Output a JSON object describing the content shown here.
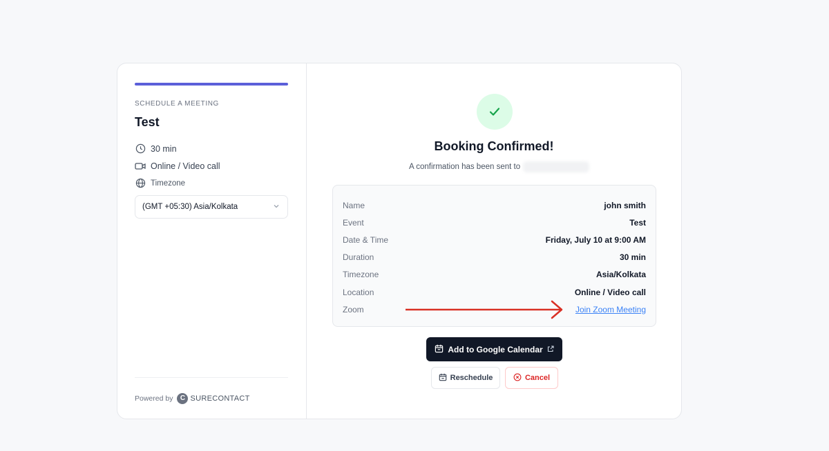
{
  "sidebar": {
    "eyebrow": "SCHEDULE A MEETING",
    "event_title": "Test",
    "duration": "30 min",
    "location": "Online / Video call",
    "timezone_label": "Timezone",
    "timezone_value": "(GMT +05:30) Asia/Kolkata",
    "powered_by": "Powered by",
    "brand_logo_letter": "C",
    "brand_name": "SURECONTACT",
    "accent_color": "#5b5fd9"
  },
  "confirmation": {
    "title": "Booking Confirmed!",
    "subtitle": "A confirmation has been sent to",
    "success_color": "#16a34a"
  },
  "details": [
    {
      "label": "Name",
      "value": "john smith"
    },
    {
      "label": "Event",
      "value": "Test"
    },
    {
      "label": "Date & Time",
      "value": "Friday, July 10 at 9:00 AM"
    },
    {
      "label": "Duration",
      "value": "30 min"
    },
    {
      "label": "Timezone",
      "value": "Asia/Kolkata"
    },
    {
      "label": "Location",
      "value": "Online / Video call"
    },
    {
      "label": "Zoom",
      "value": "Join Zoom Meeting"
    }
  ],
  "actions": {
    "add_calendar": "Add to Google Calendar",
    "reschedule": "Reschedule",
    "cancel": "Cancel"
  },
  "annotation": {
    "arrow_color": "#d93025"
  }
}
